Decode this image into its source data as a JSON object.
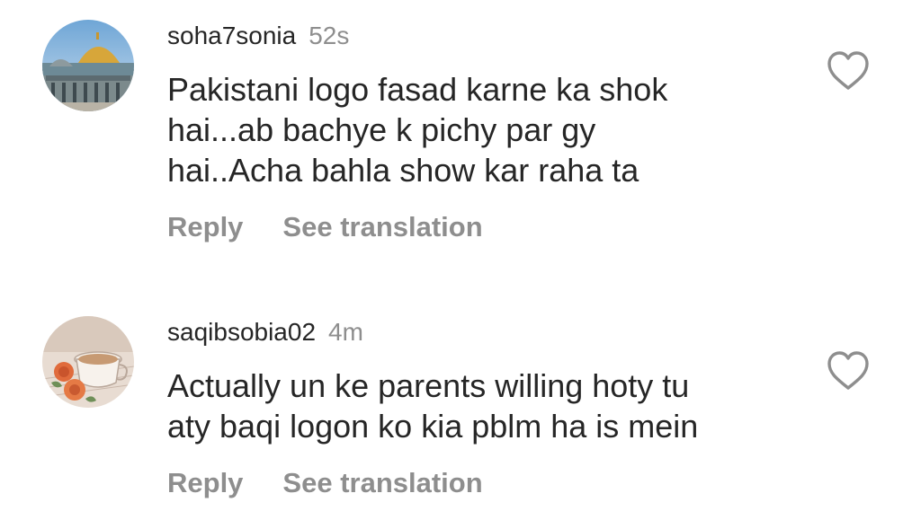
{
  "comments": [
    {
      "username": "soha7sonia",
      "time": "52s",
      "text_lines": [
        "Pakistani logo fasad karne ka shok",
        "hai...ab bachye k pichy par gy",
        "hai..Acha bahla show kar raha ta"
      ],
      "reply_label": "Reply",
      "translate_label": "See translation",
      "avatar_icon": "mosque-dome-photo",
      "like_icon": "heart-outline-icon"
    },
    {
      "username": "saqibsobia02",
      "time": "4m",
      "text_lines": [
        "Actually un ke parents willing hoty tu",
        "aty baqi logon ko kia pblm ha is mein"
      ],
      "reply_label": "Reply",
      "translate_label": "See translation",
      "avatar_icon": "coffee-cup-roses-photo",
      "like_icon": "heart-outline-icon"
    }
  ],
  "colors": {
    "primary_text": "#262626",
    "secondary_text": "#8e8e8e",
    "background": "#ffffff"
  }
}
